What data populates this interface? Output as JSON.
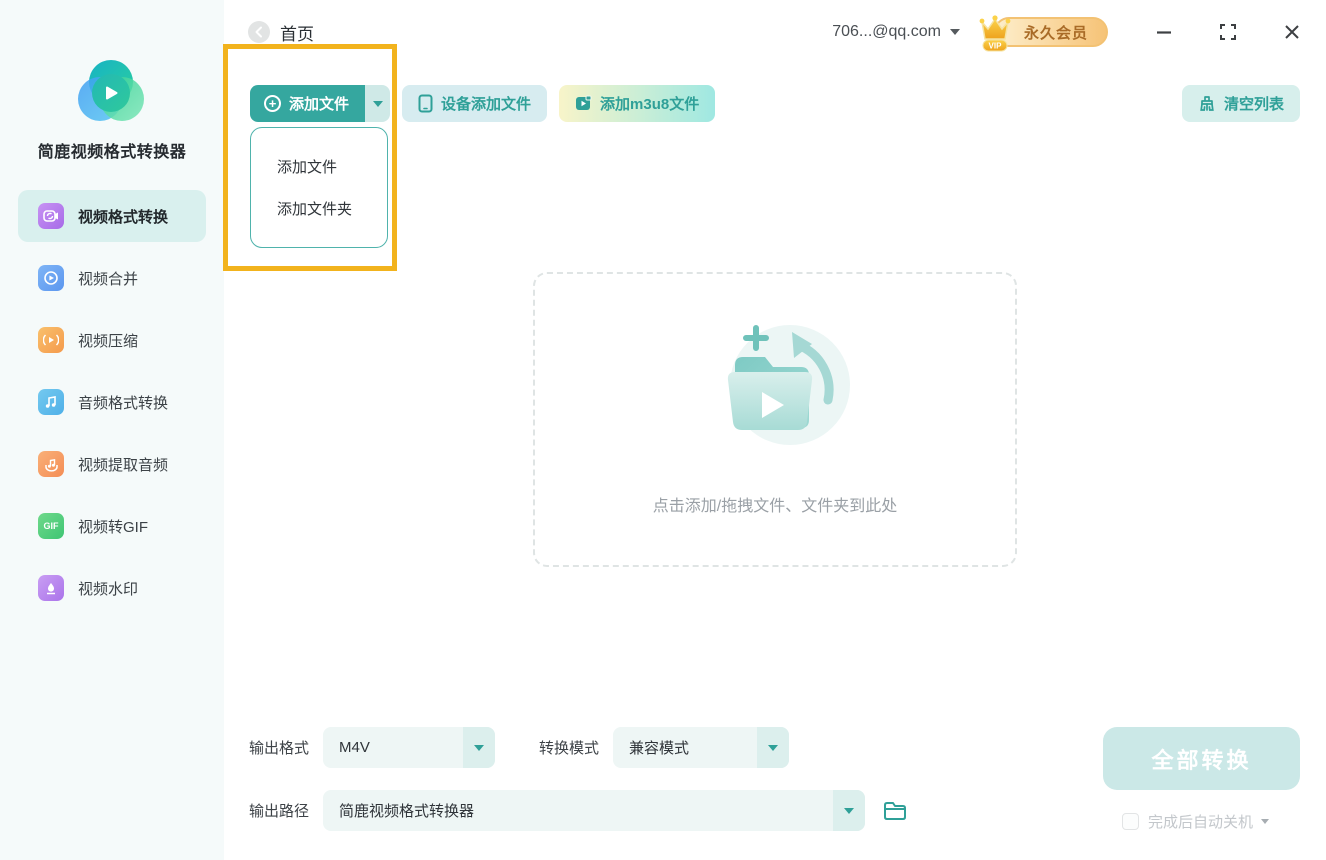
{
  "app_title": "简鹿视频格式转换器",
  "topbar": {
    "home": "首页",
    "account": "706...@qq.com",
    "vip_label": "永久会员",
    "vip_tag": "VIP"
  },
  "sidebar": [
    {
      "label": "视频格式转换",
      "active": true,
      "icon": "video-convert-icon"
    },
    {
      "label": "视频合并",
      "active": false,
      "icon": "video-merge-icon"
    },
    {
      "label": "视频压缩",
      "active": false,
      "icon": "video-compress-icon"
    },
    {
      "label": "音频格式转换",
      "active": false,
      "icon": "audio-convert-icon"
    },
    {
      "label": "视频提取音频",
      "active": false,
      "icon": "audio-extract-icon"
    },
    {
      "label": "视频转GIF",
      "active": false,
      "icon": "gif-icon"
    },
    {
      "label": "视频水印",
      "active": false,
      "icon": "watermark-icon"
    }
  ],
  "toolbar": {
    "add_file": "添加文件",
    "device_add": "设备添加文件",
    "m3u8_add": "添加m3u8文件",
    "clear_list": "清空列表"
  },
  "dropdown": {
    "items": [
      "添加文件",
      "添加文件夹"
    ]
  },
  "dropzone": {
    "hint": "点击添加/拖拽文件、文件夹到此处"
  },
  "output": {
    "format_label": "输出格式",
    "format_value": "M4V",
    "mode_label": "转换模式",
    "mode_value": "兼容模式",
    "path_label": "输出路径",
    "path_value": "简鹿视频格式转换器"
  },
  "actions": {
    "convert_all": "全部转换",
    "auto_shutdown": "完成后自动关机"
  },
  "icons": {
    "plus_glyph": "+",
    "gif_glyph": "GIF"
  },
  "colors": {
    "accent_teal": "#35a79f",
    "light_teal": "#d7efec",
    "annotation_orange": "#f2b31d",
    "vip_text": "#a96b27",
    "vip_gradient_start": "#fdeecb",
    "vip_gradient_end": "#f6c377",
    "sidebar_bg": "#f5fafa",
    "active_item_bg": "#d9f0ee",
    "hint_gray": "#9aa0a6",
    "disabled_btn_bg": "#cbe8e7"
  }
}
